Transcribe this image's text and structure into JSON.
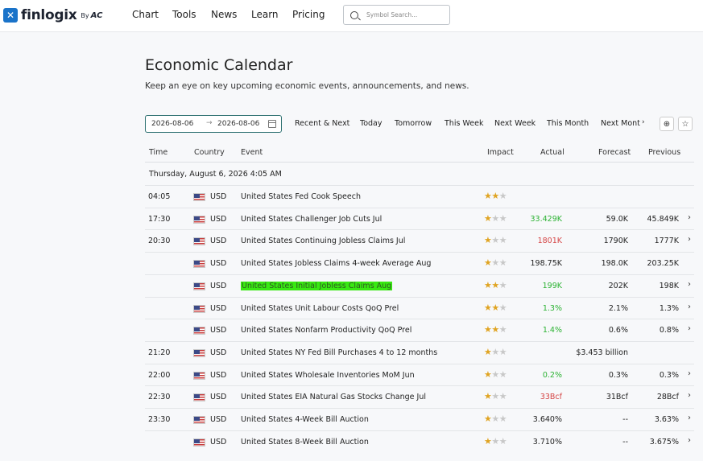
{
  "brand": {
    "name": "finlogix",
    "by": "By",
    "partner": "AC"
  },
  "nav": [
    {
      "id": "chart",
      "label": "Chart"
    },
    {
      "id": "tools",
      "label": "Tools"
    },
    {
      "id": "news",
      "label": "News"
    },
    {
      "id": "learn",
      "label": "Learn"
    },
    {
      "id": "pricing",
      "label": "Pricing"
    }
  ],
  "search": {
    "placeholder": "Symbol Search..."
  },
  "page": {
    "title": "Economic Calendar",
    "subtitle": "Keep an eye on key upcoming economic events, announcements, and news."
  },
  "date_range": {
    "from": "2026-08-06",
    "to": "2026-08-06"
  },
  "tabs": [
    "Recent & Next",
    "Today",
    "Tomorrow",
    "This Week",
    "Next Week",
    "This Month",
    "Next Mont"
  ],
  "columns": {
    "time": "Time",
    "country": "Country",
    "event": "Event",
    "impact": "Impact",
    "actual": "Actual",
    "forecast": "Forecast",
    "previous": "Previous"
  },
  "date_heading": "Thursday, August 6, 2026 4:05 AM",
  "colors": {
    "accent": "#2b6f6f",
    "positive": "#2bb232",
    "negative": "#d54545",
    "star": "#e0a422",
    "highlight": "#38e812"
  },
  "rows": [
    {
      "time": "04:05",
      "currency": "USD",
      "event": "United States Fed Cook Speech",
      "impact": 2,
      "actual": "",
      "actual_color": "",
      "forecast": "",
      "previous": "",
      "chevron": false
    },
    {
      "time": "17:30",
      "currency": "USD",
      "event": "United States Challenger Job Cuts Jul",
      "impact": 1,
      "actual": "33.429K",
      "actual_color": "green",
      "forecast": "59.0K",
      "previous": "45.849K",
      "chevron": true
    },
    {
      "time": "20:30",
      "currency": "USD",
      "event": "United States Continuing Jobless Claims Jul",
      "impact": 1,
      "actual": "1801K",
      "actual_color": "red",
      "forecast": "1790K",
      "previous": "1777K",
      "chevron": true
    },
    {
      "time": "",
      "currency": "USD",
      "event": "United States Jobless Claims 4-week Average Aug",
      "impact": 1,
      "actual": "198.75K",
      "actual_color": "",
      "forecast": "198.0K",
      "previous": "203.25K",
      "chevron": false
    },
    {
      "time": "",
      "currency": "USD",
      "event": "United States Initial Jobless Claims Aug",
      "impact": 2,
      "actual": "199K",
      "actual_color": "green",
      "forecast": "202K",
      "previous": "198K",
      "chevron": true,
      "highlight": true
    },
    {
      "time": "",
      "currency": "USD",
      "event": "United States Unit Labour Costs QoQ Prel",
      "impact": 2,
      "actual": "1.3%",
      "actual_color": "green",
      "forecast": "2.1%",
      "previous": "1.3%",
      "chevron": true
    },
    {
      "time": "",
      "currency": "USD",
      "event": "United States Nonfarm Productivity QoQ Prel",
      "impact": 2,
      "actual": "1.4%",
      "actual_color": "green",
      "forecast": "0.6%",
      "previous": "0.8%",
      "chevron": true
    },
    {
      "time": "21:20",
      "currency": "USD",
      "event": "United States NY Fed Bill Purchases 4 to 12 months",
      "impact": 1,
      "actual": "",
      "actual_color": "",
      "forecast": "$3.453 billion",
      "previous": "",
      "chevron": false
    },
    {
      "time": "22:00",
      "currency": "USD",
      "event": "United States Wholesale Inventories MoM Jun",
      "impact": 1,
      "actual": "0.2%",
      "actual_color": "green",
      "forecast": "0.3%",
      "previous": "0.3%",
      "chevron": true
    },
    {
      "time": "22:30",
      "currency": "USD",
      "event": "United States EIA Natural Gas Stocks Change Jul",
      "impact": 1,
      "actual": "33Bcf",
      "actual_color": "red",
      "forecast": "31Bcf",
      "previous": "28Bcf",
      "chevron": true
    },
    {
      "time": "23:30",
      "currency": "USD",
      "event": "United States 4-Week Bill Auction",
      "impact": 1,
      "actual": "3.640%",
      "actual_color": "",
      "forecast": "--",
      "previous": "3.63%",
      "chevron": true
    },
    {
      "time": "",
      "currency": "USD",
      "event": "United States 8-Week Bill Auction",
      "impact": 1,
      "actual": "3.710%",
      "actual_color": "",
      "forecast": "--",
      "previous": "3.675%",
      "chevron": true
    }
  ]
}
